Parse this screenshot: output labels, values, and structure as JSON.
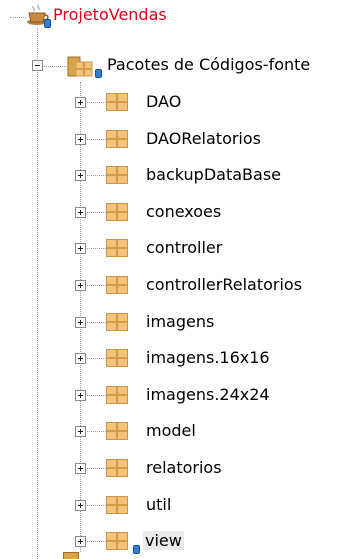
{
  "project": {
    "name": "ProjetoVendas",
    "icon": "coffee-cup-icon"
  },
  "source_packages": {
    "label": "Pacotes de Códigos-fonte",
    "icon": "source-packages-icon",
    "expanded": true
  },
  "packages": [
    {
      "label": "DAO",
      "icon": "package-icon",
      "expanded": false
    },
    {
      "label": "DAORelatorios",
      "icon": "package-icon",
      "expanded": false
    },
    {
      "label": "backupDataBase",
      "icon": "package-icon",
      "expanded": false
    },
    {
      "label": "conexoes",
      "icon": "package-icon",
      "expanded": false
    },
    {
      "label": "controller",
      "icon": "package-icon",
      "expanded": false
    },
    {
      "label": "controllerRelatorios",
      "icon": "package-icon",
      "expanded": false
    },
    {
      "label": "imagens",
      "icon": "package-icon",
      "expanded": false
    },
    {
      "label": "imagens.16x16",
      "icon": "package-icon",
      "expanded": false
    },
    {
      "label": "imagens.24x24",
      "icon": "package-icon",
      "expanded": false
    },
    {
      "label": "model",
      "icon": "package-icon",
      "expanded": false
    },
    {
      "label": "relatorios",
      "icon": "package-icon",
      "expanded": false
    },
    {
      "label": "util",
      "icon": "package-icon",
      "expanded": false
    },
    {
      "label": "view",
      "icon": "package-icon",
      "expanded": false,
      "selected": true
    }
  ],
  "colors": {
    "project_text": "#e0001f",
    "package_fill": "#f3c37b",
    "badge_blue": "#2f7fd6"
  }
}
